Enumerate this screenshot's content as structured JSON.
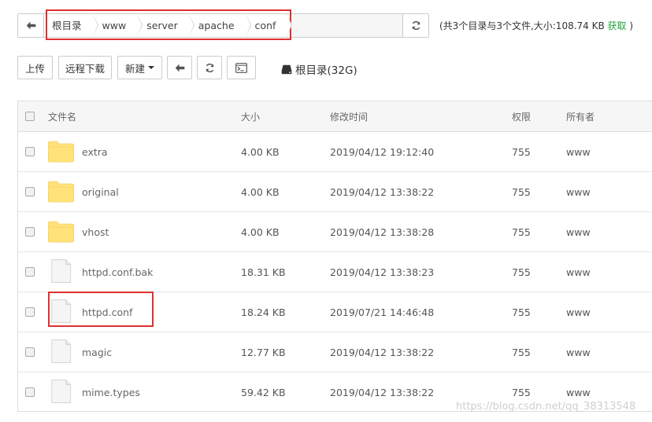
{
  "path_bar": {
    "crumbs": [
      "根目录",
      "www",
      "server",
      "apache",
      "conf"
    ]
  },
  "summary": {
    "text": "(共3个目录与3个文件,大小:108.74 KB",
    "refresh_link": "获取",
    "close": ")"
  },
  "toolbar": {
    "upload_label": "上传",
    "remote_download_label": "远程下载",
    "new_label": "新建",
    "disk_label": "根目录(32G)"
  },
  "table": {
    "headers": {
      "name": "文件名",
      "size": "大小",
      "modified": "修改时间",
      "permission": "权限",
      "owner": "所有者"
    },
    "rows": [
      {
        "type": "folder",
        "name": "extra",
        "size": "4.00 KB",
        "modified": "2019/04/12 19:12:40",
        "permission": "755",
        "owner": "www"
      },
      {
        "type": "folder",
        "name": "original",
        "size": "4.00 KB",
        "modified": "2019/04/12 13:38:22",
        "permission": "755",
        "owner": "www"
      },
      {
        "type": "folder",
        "name": "vhost",
        "size": "4.00 KB",
        "modified": "2019/04/12 13:38:28",
        "permission": "755",
        "owner": "www"
      },
      {
        "type": "file",
        "name": "httpd.conf.bak",
        "size": "18.31 KB",
        "modified": "2019/04/12 13:38:23",
        "permission": "755",
        "owner": "www"
      },
      {
        "type": "file",
        "name": "httpd.conf",
        "size": "18.24 KB",
        "modified": "2019/07/21 14:46:48",
        "permission": "755",
        "owner": "www"
      },
      {
        "type": "file",
        "name": "magic",
        "size": "12.77 KB",
        "modified": "2019/04/12 13:38:22",
        "permission": "755",
        "owner": "www"
      },
      {
        "type": "file",
        "name": "mime.types",
        "size": "59.42 KB",
        "modified": "2019/04/12 13:38:22",
        "permission": "755",
        "owner": "www"
      }
    ]
  },
  "watermark": "https://blog.csdn.net/qq_38313548",
  "colors": {
    "accent_green": "#20a53a",
    "highlight_red": "#e03131",
    "folder_yellow": "#ffe27a"
  },
  "icons": {
    "back": "arrow-left-icon",
    "refresh": "refresh-icon",
    "terminal": "terminal-icon",
    "disk": "hdd-icon",
    "folder": "folder-icon",
    "file": "file-icon"
  }
}
